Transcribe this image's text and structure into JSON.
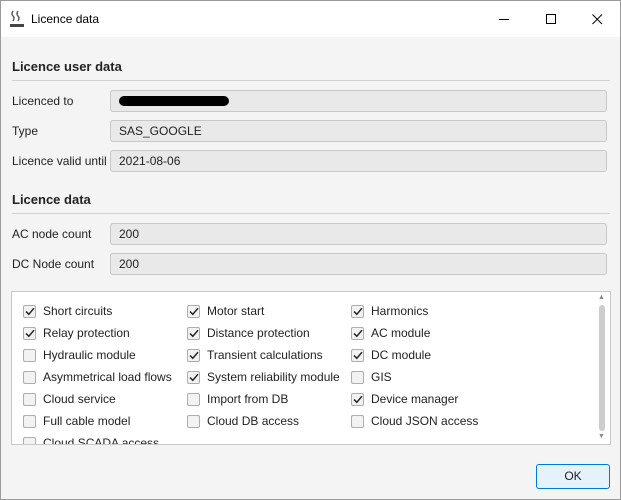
{
  "window": {
    "title": "Licence data",
    "icon": "app-logo-icon"
  },
  "user_section": {
    "title": "Licence user data",
    "fields": [
      {
        "label": "Licenced to",
        "value": "",
        "redacted": true
      },
      {
        "label": "Type",
        "value": "SAS_GOOGLE"
      },
      {
        "label": "Licence valid until",
        "value": "2021-08-06"
      }
    ]
  },
  "licence_section": {
    "title": "Licence data",
    "fields": [
      {
        "label": "AC node count",
        "value": "200"
      },
      {
        "label": "DC Node count",
        "value": "200"
      }
    ]
  },
  "modules": [
    {
      "label": "Short circuits",
      "checked": true
    },
    {
      "label": "Motor start",
      "checked": true
    },
    {
      "label": "Harmonics",
      "checked": true
    },
    {
      "label": "Relay protection",
      "checked": true
    },
    {
      "label": "Distance protection",
      "checked": true
    },
    {
      "label": "AC module",
      "checked": true
    },
    {
      "label": "Hydraulic module",
      "checked": false
    },
    {
      "label": "Transient calculations",
      "checked": true
    },
    {
      "label": "DC module",
      "checked": true
    },
    {
      "label": "Asymmetrical load flows",
      "checked": false
    },
    {
      "label": "System reliability module",
      "checked": true
    },
    {
      "label": "GIS",
      "checked": false
    },
    {
      "label": "Cloud service",
      "checked": false
    },
    {
      "label": "Import from DB",
      "checked": false
    },
    {
      "label": "Device manager",
      "checked": true
    },
    {
      "label": "Full cable model",
      "checked": false
    },
    {
      "label": "Cloud DB access",
      "checked": false
    },
    {
      "label": "Cloud JSON access",
      "checked": false
    },
    {
      "label": "Cloud SCADA access",
      "checked": false
    }
  ],
  "ok_label": "OK",
  "colors": {
    "accent": "#0078d7",
    "field_bg": "#e9e9e9",
    "dialog_bg": "#f4f4f4"
  }
}
